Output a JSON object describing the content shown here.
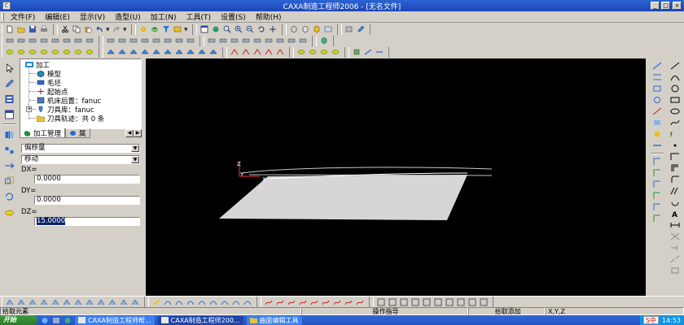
{
  "window": {
    "title": "CAXA制造工程师2006 - [无名文件]",
    "app_icon": "caxa-logo-icon",
    "minimize": "_",
    "maximize": "□",
    "close": "×"
  },
  "menu": [
    {
      "label": "文件(F)"
    },
    {
      "label": "编辑(E)"
    },
    {
      "label": "显示(V)"
    },
    {
      "label": "造型(U)"
    },
    {
      "label": "加工(N)"
    },
    {
      "label": "工具(T)"
    },
    {
      "label": "设置(S)"
    },
    {
      "label": "帮助(H)"
    }
  ],
  "tree": {
    "root": "加工",
    "nodes": [
      {
        "label": "模型",
        "icon": "model-icon"
      },
      {
        "label": "毛坯",
        "icon": "blank-stock-icon"
      },
      {
        "label": "起始点",
        "icon": "start-point-icon"
      },
      {
        "label": "机床后置：fanuc",
        "icon": "machine-post-icon"
      },
      {
        "label": "刀具库：fanuc",
        "icon": "tool-library-icon"
      },
      {
        "label": "刀具轨迹：共 0 条",
        "icon": "toolpath-folder-icon"
      }
    ]
  },
  "tabs": [
    {
      "label": "加工管理",
      "icon": "machining-manager-icon"
    },
    {
      "label": "属",
      "icon": "properties-icon"
    }
  ],
  "props": {
    "combo1": "偏移量",
    "combo2": "移动",
    "dx_label": "DX=",
    "dx_value": "0.0000",
    "dy_label": "DY=",
    "dy_value": "0.0000",
    "dz_label": "DZ=",
    "dz_value": "15.0000"
  },
  "canvas": {
    "axis_x": "X",
    "axis_y": "Y",
    "axis_z": "Z"
  },
  "statusbar": {
    "left": "拾取元素",
    "center": "操作指导",
    "right_hint": "拾取添加",
    "coords": "X,Y,Z"
  },
  "taskbar": {
    "start": "开始",
    "tasks": [
      {
        "label": "CAXA制造工程师帮...",
        "active": false
      },
      {
        "label": "CAXA制造工程师200...",
        "active": true
      },
      {
        "label": "曲面编辑工具",
        "active": false
      }
    ],
    "ime": "S中",
    "clock": "14:53"
  },
  "colors": {
    "titlebar": "#1c46b4",
    "canvas_bg": "#000000",
    "surface": "#d8d5d8",
    "selection": "#0a246a"
  }
}
